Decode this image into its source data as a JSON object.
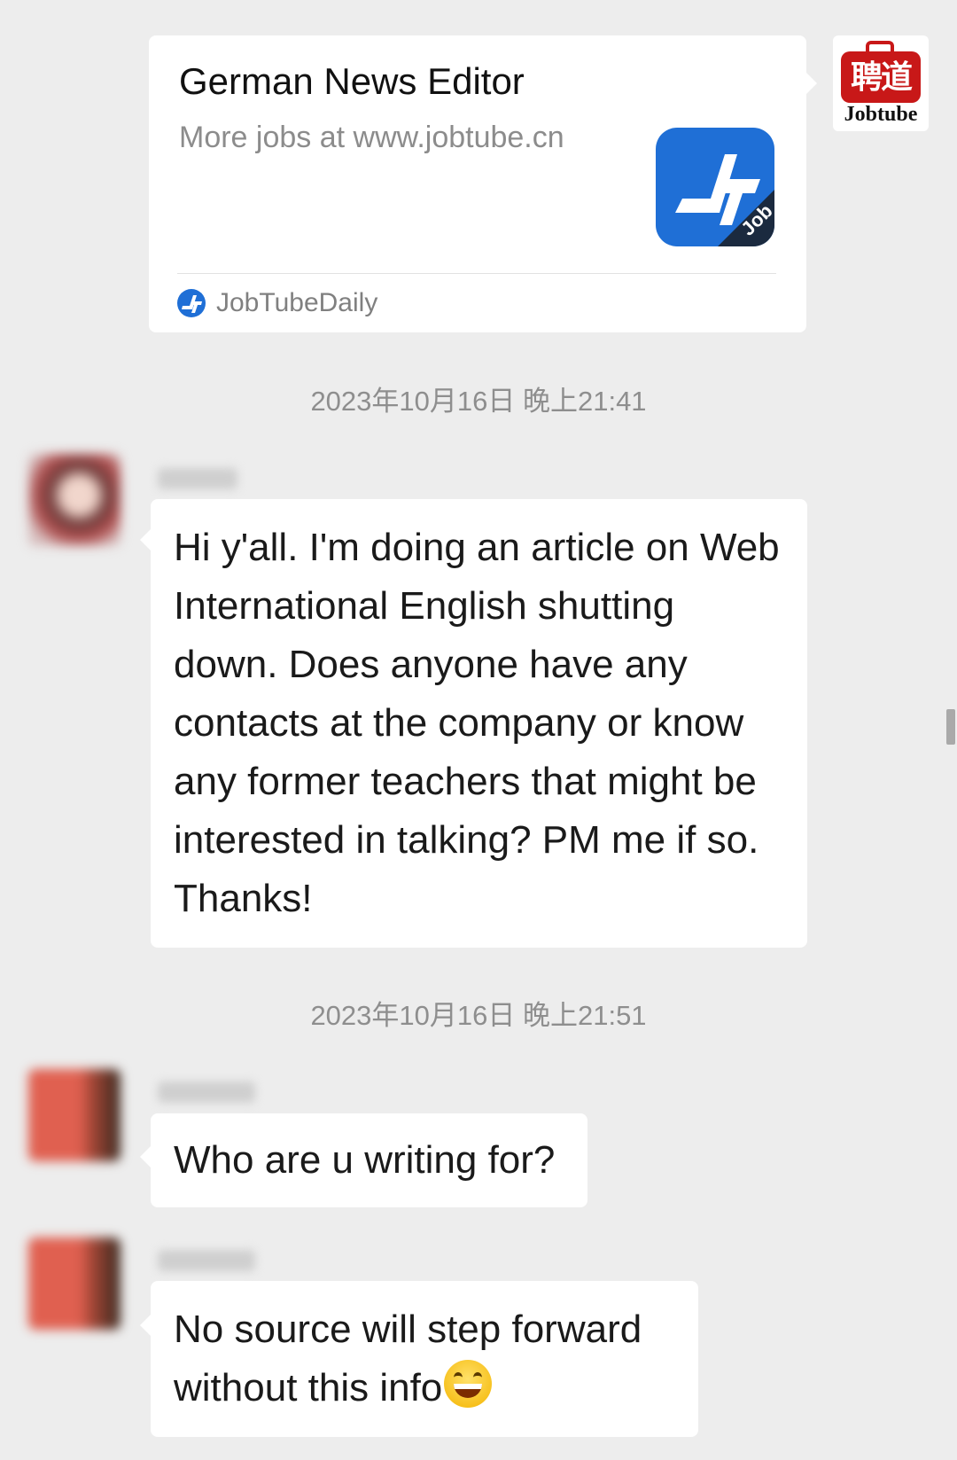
{
  "shared_card": {
    "title": "German News Editor",
    "description": "More jobs at www.jobtube.cn",
    "thumbnail_text": "Job",
    "source_name": "JobTubeDaily"
  },
  "sender_avatar": {
    "chinese_text": "聘道",
    "brand_text": "Jobtube"
  },
  "messages": [
    {
      "timestamp": "2023年10月16日 晚上21:41",
      "text": "Hi y'all. I'm doing an article on Web International English shutting down. Does anyone have any contacts at the company or know any former teachers that might be interested in talking? PM me if so. Thanks!"
    },
    {
      "timestamp": "2023年10月16日 晚上21:51",
      "text": "Who are u writing for?"
    },
    {
      "text": "No source will step forward without this info",
      "emoji": "grinning-face"
    }
  ],
  "colors": {
    "background": "#ededed",
    "bubble": "#ffffff",
    "brand_blue": "#1f6fd6",
    "brand_red": "#c81818",
    "muted_text": "#8e8e8e"
  }
}
